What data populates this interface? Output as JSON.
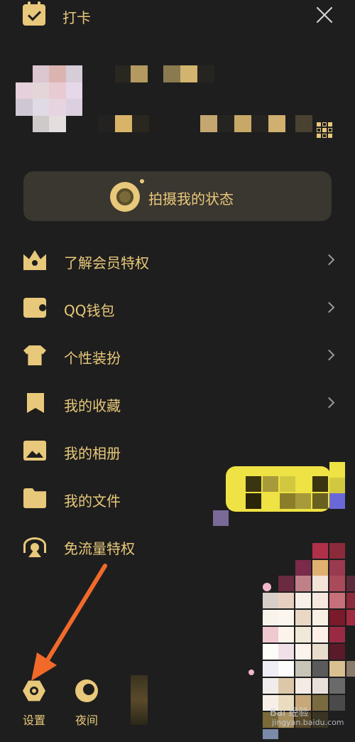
{
  "topbar": {
    "checkin_label": "打卡"
  },
  "status": {
    "label": "拍摄我的状态"
  },
  "menu": [
    {
      "label": "了解会员特权",
      "icon": "crown-icon"
    },
    {
      "label": "QQ钱包",
      "icon": "wallet-icon"
    },
    {
      "label": "个性装扮",
      "icon": "shirt-icon"
    },
    {
      "label": "我的收藏",
      "icon": "bookmark-icon"
    },
    {
      "label": "我的相册",
      "icon": "photo-icon"
    },
    {
      "label": "我的文件",
      "icon": "folder-icon"
    },
    {
      "label": "免流量特权",
      "icon": "antenna-icon"
    }
  ],
  "bottom": {
    "settings_label": "设置",
    "night_label": "夜间"
  },
  "watermark": {
    "line1": "Bai 经验",
    "line2": "jingyan.baidu.com"
  },
  "colors": {
    "accent": "#e8c87a",
    "background": "#1e1e1e",
    "arrow": "#f26a2a"
  }
}
